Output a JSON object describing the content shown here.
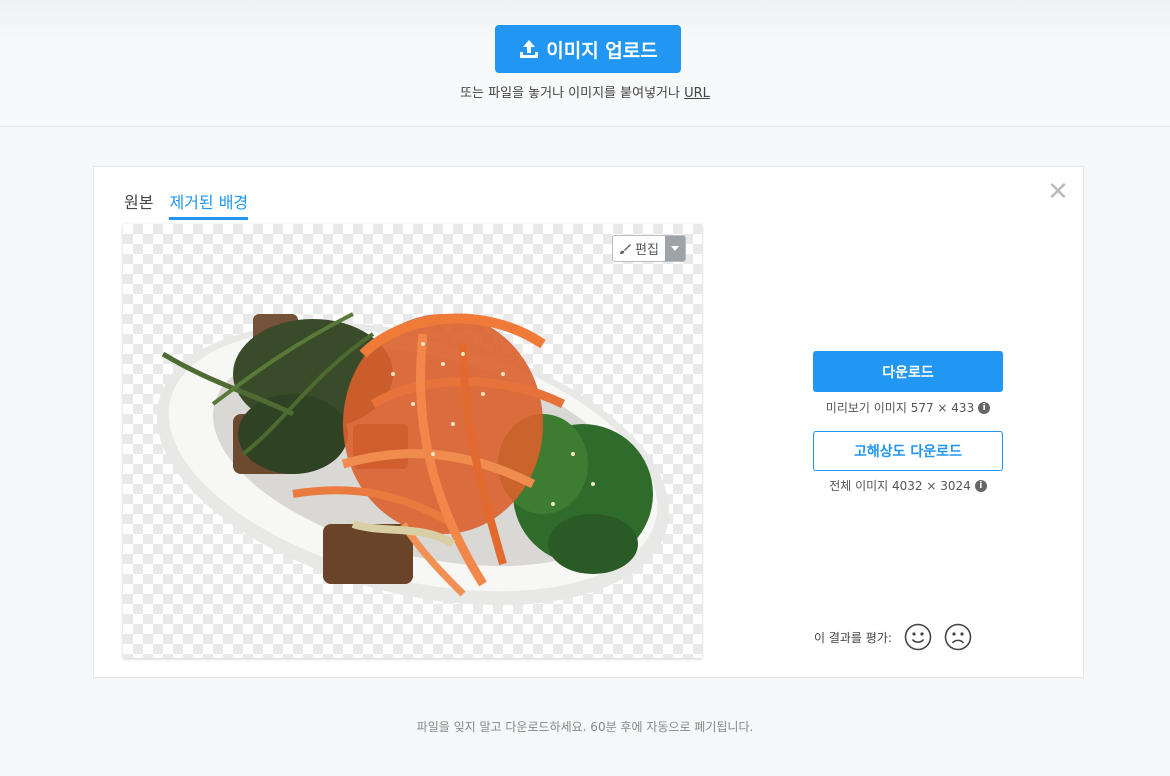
{
  "header": {
    "upload_label": "이미지 업로드",
    "upload_icon": "upload-icon",
    "sub_text": "또는 파일을 놓거나 이미지를 붙여넣거나",
    "sub_link": "URL"
  },
  "tabs": [
    {
      "label": "원본",
      "active": false
    },
    {
      "label": "제거된 배경",
      "active": true
    }
  ],
  "preview": {
    "edit_label": "편집",
    "edit_icon": "brush-icon",
    "caret_icon": "chevron-down-icon"
  },
  "download": {
    "label": "다운로드",
    "info": "미리보기 이미지 577 × 433",
    "hd_label": "고해상도 다운로드",
    "hd_info": "전체 이미지 4032 × 3024",
    "info_icon": "info-icon"
  },
  "rating": {
    "label": "이 결과를 평가:",
    "icons": [
      "smile-icon",
      "frown-icon"
    ]
  },
  "close_icon": "close-icon",
  "footer": "파일을 잊지 말고 다운로드하세요. 60분 후에 자동으로 폐기됩니다.",
  "colors": {
    "accent": "#2196f3",
    "background": "#f6f7f9"
  }
}
